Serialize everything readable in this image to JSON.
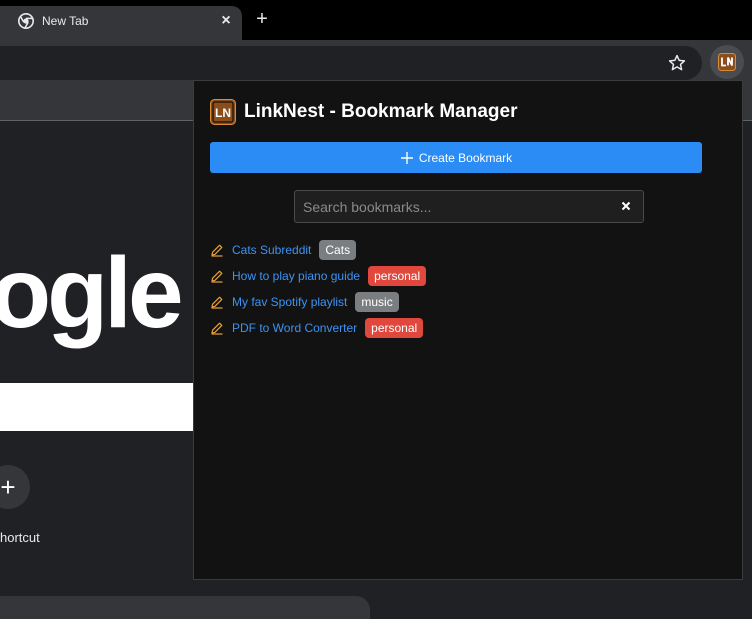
{
  "browser": {
    "tab": {
      "title": "New Tab",
      "favicon": "chrome-icon"
    },
    "new_tab_symbol": "+",
    "close_symbol": "×"
  },
  "ntp": {
    "logo_fragment": "ogle",
    "shortcut_symbol": "+",
    "shortcut_label": "hortcut"
  },
  "popup": {
    "logo_text": "LN",
    "title": "LinkNest - Bookmark Manager",
    "create_label": "Create Bookmark",
    "search": {
      "placeholder": "Search bookmarks...",
      "value": ""
    },
    "bookmarks": [
      {
        "title": "Cats Subreddit",
        "tag": "Cats",
        "tag_color": "#7b7e80"
      },
      {
        "title": "How to play piano guide",
        "tag": "personal",
        "tag_color": "#e0483e"
      },
      {
        "title": "My fav Spotify playlist",
        "tag": "music",
        "tag_color": "#7b7e80"
      },
      {
        "title": "PDF to Word Converter",
        "tag": "personal",
        "tag_color": "#e0483e"
      }
    ]
  },
  "colors": {
    "accent": "#2a8cf4",
    "link": "#3d93f5",
    "edit_icon": "#e8a13a",
    "logo_bg": "#8a4e1c"
  }
}
